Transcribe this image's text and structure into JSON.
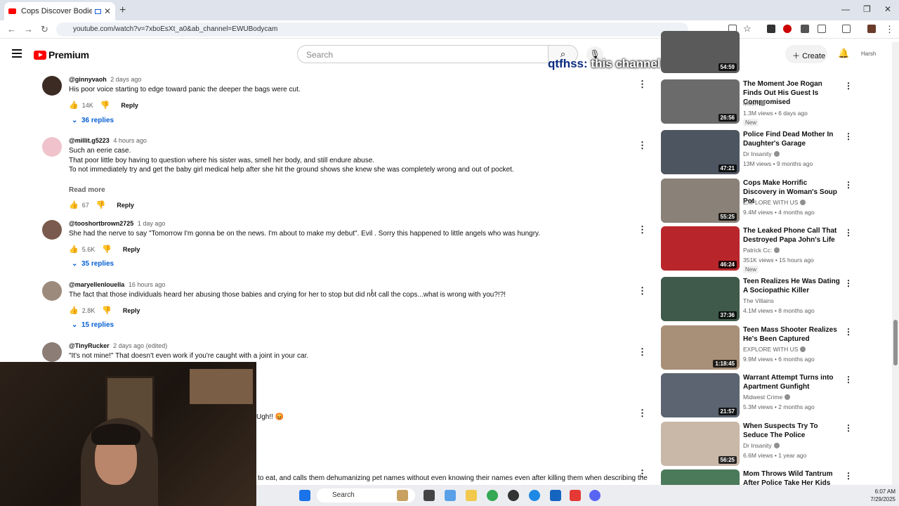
{
  "browser": {
    "tab_title": "Cops Discover Bodies in W",
    "new_tab": "+",
    "url": "youtube.com/watch?v=7xboEsXt_a0&ab_channel=EWUBodycam"
  },
  "header": {
    "logo": "Premium",
    "search_placeholder": "Search",
    "create_label": "Create",
    "account": "Harsh",
    "chat_overlay_name": "qtfhss:",
    "chat_overlay_text": "this channel is so fire"
  },
  "comments": [
    {
      "handle": "@ginnyvaoh",
      "time": "2 days ago",
      "lines": [
        "His poor voice starting to edge toward panic the deeper the bags were cut."
      ],
      "likes": "14K",
      "reply": "Reply",
      "replies": "36 replies",
      "avatar_color": "#3b2b22"
    },
    {
      "handle": "@millit.g5223",
      "time": "4 hours ago",
      "lines": [
        "Such an eerie case.",
        "That poor little boy having to question where his sister was, smell her body, and still endure abuse.",
        "To not immediately try and get the baby girl medical help after she hit the ground shows she knew she was completely wrong and out of pocket."
      ],
      "read_more": "Read more",
      "likes": "67",
      "reply": "Reply",
      "avatar_color": "#f0c3cc"
    },
    {
      "handle": "@tooshortbrown2725",
      "time": "1 day ago",
      "lines": [
        "She had the nerve to say \"Tomorrow I'm gonna be on the news. I'm about to make my debut\". Evil . Sorry this happened to little angels who was hungry."
      ],
      "likes": "5.6K",
      "reply": "Reply",
      "replies": "35 replies",
      "avatar_color": "#7a5a4e"
    },
    {
      "handle": "@maryellenlouella",
      "time": "16 hours ago",
      "lines": [
        "The fact that those individuals heard her abusing those babies and crying for her to stop but did not call the cops...what is wrong with you?!?!"
      ],
      "likes": "2.8K",
      "reply": "Reply",
      "replies": "15 replies",
      "avatar_color": "#9c8a7d"
    },
    {
      "handle": "@TinyRucker",
      "time": "2 days ago (edited)",
      "lines": [
        "\"It's not mine!\" That doesn't even work if you're caught with a joint in your car."
      ],
      "avatar_color": "#8c7d76"
    }
  ],
  "partial_lines": {
    "line1": "Ugh!! 😡",
    "line2": "to eat, and calls them dehumanizing pet names without even knowing their names even after killing them when describing the"
  },
  "sidebar": [
    {
      "title": "",
      "channel": "",
      "meta": "",
      "duration": "54:59",
      "thumb": "#5a5a5a"
    },
    {
      "title": "The Moment Joe Rogan Finds Out His Guest Is Compromised",
      "channel": "Moon",
      "meta": "1.3M views • 6 days ago",
      "new": "New",
      "duration": "26:56",
      "thumb": "#6b6b6b"
    },
    {
      "title": "Police Find Dead Mother In Daughter's Garage",
      "channel": "Dr Insanity",
      "meta": "13M views • 9 months ago",
      "duration": "47:21",
      "thumb": "#4d5561"
    },
    {
      "title": "Cops Make Horrific Discovery in Woman's Soup Pot",
      "channel": "EXPLORE WITH US",
      "meta": "9.4M views • 4 months ago",
      "duration": "55:25",
      "thumb": "#8a8178"
    },
    {
      "title": "The Leaked Phone Call That Destroyed Papa John's Life",
      "channel": "Patrick Cc:",
      "meta": "351K views • 15 hours ago",
      "new": "New",
      "duration": "46:24",
      "thumb": "#b8262b"
    },
    {
      "title": "Teen Realizes He Was Dating A Sociopathic Killer",
      "channel": "The Villains",
      "meta": "4.1M views • 8 months ago",
      "duration": "37:36",
      "thumb": "#3f5a4a"
    },
    {
      "title": "Teen Mass Shooter Realizes He's Been Captured",
      "channel": "EXPLORE WITH US",
      "meta": "9.9M views • 6 months ago",
      "duration": "1:18:45",
      "thumb": "#a88f78"
    },
    {
      "title": "Warrant Attempt Turns into Apartment Gunfight",
      "channel": "Midwest Crime",
      "meta": "5.3M views • 2 months ago",
      "duration": "21:57",
      "thumb": "#5b6470"
    },
    {
      "title": "When Suspects Try To Seduce The Police",
      "channel": "Dr Insanity",
      "meta": "6.6M views • 1 year ago",
      "duration": "56:25",
      "thumb": "#c9b7a8"
    },
    {
      "title": "Mom Throws Wild Tantrum After Police Take Her Kids",
      "channel": "",
      "meta": "",
      "duration": "",
      "thumb": "#4b7a5a"
    }
  ],
  "taskbar": {
    "search": "Search",
    "time": "6:07 AM",
    "date": "7/29/2025"
  }
}
